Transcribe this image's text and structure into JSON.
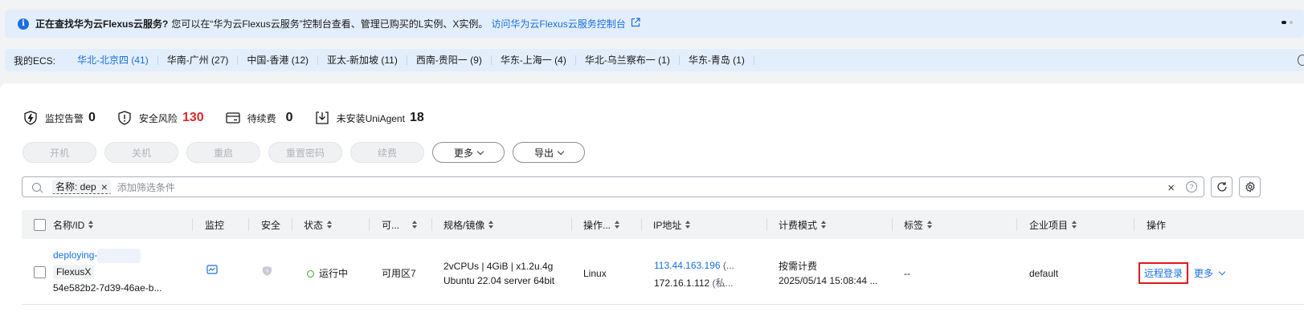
{
  "notice": {
    "title": "正在查找华为云Flexus云服务?",
    "text": "您可以在“华为云Flexus云服务”控制台查看、管理已购买的L实例、X实例。",
    "link": "访问华为云Flexus云服务控制台"
  },
  "ecs": {
    "label": "我的ECS:",
    "regions": [
      {
        "name": "华北-北京四 (41)",
        "active": true
      },
      {
        "name": "华南-广州 (27)",
        "active": false
      },
      {
        "name": "中国-香港 (12)",
        "active": false
      },
      {
        "name": "亚太-新加坡 (11)",
        "active": false
      },
      {
        "name": "西南-贵阳一 (9)",
        "active": false
      },
      {
        "name": "华东-上海一 (4)",
        "active": false
      },
      {
        "name": "华北-乌兰察布一 (1)",
        "active": false
      },
      {
        "name": "华东-青岛 (1)",
        "active": false
      }
    ]
  },
  "stats": {
    "monitor_label": "监控告警",
    "monitor_value": "0",
    "risk_label": "安全风险",
    "risk_value": "130",
    "renew_label": "待续费",
    "renew_value": "0",
    "agent_label": "未安装UniAgent",
    "agent_value": "18"
  },
  "toolbar": {
    "start": "开机",
    "stop": "关机",
    "restart": "重启",
    "reset_pwd": "重置密码",
    "renew": "续费",
    "more": "更多",
    "export": "导出"
  },
  "filter": {
    "chip": "名称: dep",
    "placeholder": "添加筛选条件"
  },
  "table": {
    "headers": {
      "name": "名称/ID",
      "monitor": "监控",
      "security": "安全",
      "status": "状态",
      "az": "可...",
      "spec": "规格/镜像",
      "os": "操作...",
      "ip": "IP地址",
      "billing": "计费模式",
      "tags": "标签",
      "project": "企业项目",
      "ops": "操作"
    },
    "row": {
      "name": "deploying-",
      "tag": "FlexusX",
      "id": "54e582b2-7d39-46ae-b...",
      "status": "运行中",
      "az": "可用区7",
      "spec": "2vCPUs | 4GiB | x1.2u.4g",
      "image": "Ubuntu 22.04 server 64bit",
      "os": "Linux",
      "ip_public": "113.44.163.196",
      "ip_public_suffix": "(...",
      "ip_private": "172.16.1.112",
      "ip_private_suffix": "(私...",
      "billing": "按需计费",
      "billing_time": "2025/05/14 15:08:44 ...",
      "tags": "--",
      "project": "default",
      "remote_login": "远程登录",
      "more": "更多"
    }
  },
  "colors": {
    "accent": "#1a6fe0",
    "danger": "#e0282b",
    "running": "#3aa83a"
  }
}
